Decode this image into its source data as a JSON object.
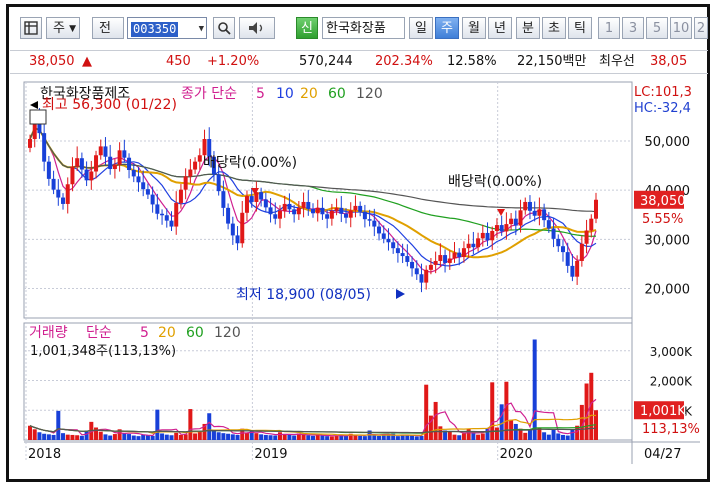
{
  "toolbar": {
    "layout_icon": "layout-icon",
    "type_label": "주",
    "period_label": "전",
    "stock_code": "003350",
    "search_icon": "search-icon",
    "speaker_icon": "speaker-icon",
    "new_label": "신",
    "stock_name": "한국화장품",
    "periods": [
      "일",
      "주",
      "월",
      "년",
      "분",
      "초",
      "틱"
    ],
    "active_period": "주",
    "numbers": [
      "1",
      "3",
      "5",
      "10",
      "2"
    ]
  },
  "quote": {
    "price": "38,050",
    "change_arrow": "▲",
    "change": "450",
    "change_pct": "+1.20%",
    "volume": "570,244",
    "volume_ratio": "202.34%",
    "turnover": "12.58%",
    "amount": "22,150백만",
    "pref_name": "최우선",
    "pref_price": "38,05"
  },
  "chart_data": [
    {
      "type": "candlestick",
      "title": "한국화장품제조",
      "indicator_label": "종가 단순",
      "ma_periods": [
        "5",
        "10",
        "20",
        "60",
        "120"
      ],
      "ma_colors": [
        "#d02090",
        "#2040e0",
        "#e0a000",
        "#20a020",
        "#555555"
      ],
      "price_ticks": [
        "50,000",
        "40,000",
        "30,000",
        "20,000"
      ],
      "price_tick_values": [
        50000,
        40000,
        30000,
        20000
      ],
      "ylim": [
        14000,
        62000
      ],
      "x_ticks": [
        "2018",
        "2019",
        "2020"
      ],
      "last_date": "04/27",
      "lc_label": "LC:101,3",
      "hc_label": "HC:-32,4",
      "current_price": "38,050",
      "current_change": "5.55%",
      "current_value": 38050,
      "annotations": {
        "high": "최고 56,300 (01/22)",
        "high_value": 56300,
        "low": "최저 18,900 (08/05)",
        "low_value": 18900,
        "dividend1": "배당락(0.00%)",
        "dividend2": "배당락(0.00%)"
      },
      "close": [
        50400,
        54800,
        51600,
        45800,
        42300,
        40100,
        38500,
        37200,
        41200,
        44800,
        46500,
        44200,
        42000,
        43800,
        47100,
        48900,
        46800,
        44300,
        45200,
        48100,
        46600,
        44100,
        42800,
        41600,
        40200,
        39100,
        37100,
        35200,
        34900,
        33800,
        32600,
        37400,
        40100,
        42800,
        44200,
        45800,
        47100,
        50400,
        46800,
        43200,
        39800,
        36400,
        33200,
        30800,
        29200,
        35400,
        38800,
        37600,
        39600,
        38100,
        36500,
        35100,
        34200,
        35800,
        37200,
        36100,
        35100,
        36400,
        37600,
        36200,
        35300,
        36400,
        35100,
        34200,
        35800,
        36400,
        35200,
        34400,
        35900,
        36800,
        35600,
        34100,
        33800,
        32600,
        31200,
        30100,
        29400,
        28200,
        27200,
        26600,
        25400,
        24100,
        22900,
        21200,
        23800,
        24800,
        25600,
        26800,
        25200,
        26100,
        27300,
        26400,
        28200,
        29100,
        28400,
        30200,
        31300,
        29800,
        31700,
        32900,
        31600,
        33100,
        34200,
        32800,
        35900,
        37600,
        35800,
        34800,
        36100,
        33900,
        32200,
        30100,
        28600,
        27400,
        24600,
        22400,
        25600,
        29100,
        31800,
        34200,
        38050
      ],
      "volume_k": [
        480,
        360,
        260,
        210,
        190,
        170,
        980,
        230,
        180,
        170,
        160,
        140,
        320,
        610,
        420,
        280,
        190,
        150,
        200,
        360,
        230,
        200,
        150,
        130,
        180,
        150,
        140,
        1020,
        220,
        180,
        160,
        240,
        170,
        190,
        1040,
        220,
        280,
        540,
        900,
        310,
        260,
        230,
        210,
        190,
        170,
        380,
        240,
        290,
        230,
        190,
        170,
        160,
        150,
        260,
        200,
        170,
        150,
        220,
        180,
        160,
        140,
        180,
        150,
        130,
        120,
        150,
        170,
        140,
        210,
        160,
        140,
        130,
        320,
        150,
        140,
        180,
        160,
        210,
        130,
        160,
        180,
        150,
        120,
        140,
        1860,
        820,
        1280,
        460,
        320,
        280,
        180,
        160,
        220,
        380,
        260,
        180,
        220,
        380,
        1940,
        420,
        1200,
        1960,
        680,
        540,
        380,
        240,
        360,
        3380,
        420,
        260,
        180,
        340,
        220,
        170,
        150,
        360,
        480,
        1180,
        1900,
        2260,
        1001
      ],
      "volume_ticks": [
        "3,000K",
        "2,000K",
        "1,000K"
      ],
      "volume_tick_values": [
        3000,
        2000,
        1000
      ]
    },
    {
      "type": "bar",
      "title": "거래량",
      "indicator_label": "단순",
      "ma_periods": [
        "5",
        "20",
        "60",
        "120"
      ],
      "ma_colors": [
        "#d02090",
        "#e0a000",
        "#20a020",
        "#555555"
      ],
      "volume_info": "1,001,348주(113,13%)",
      "current_volume": "1,001K",
      "current_volume_pct": "113,13%"
    }
  ]
}
